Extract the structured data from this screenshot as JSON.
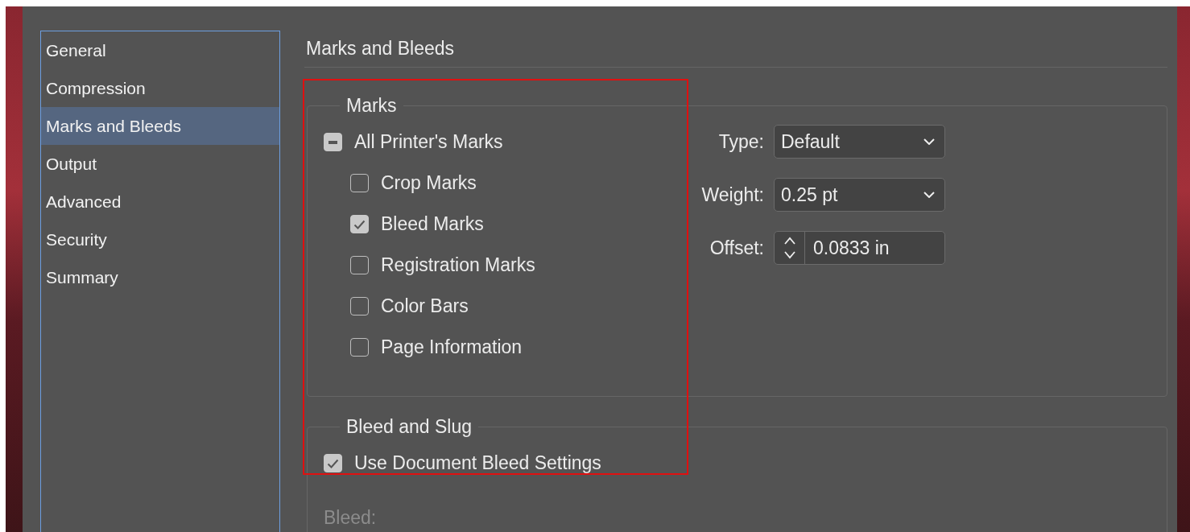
{
  "sidebar": {
    "items": [
      {
        "label": "General",
        "selected": false
      },
      {
        "label": "Compression",
        "selected": false
      },
      {
        "label": "Marks and Bleeds",
        "selected": true
      },
      {
        "label": "Output",
        "selected": false
      },
      {
        "label": "Advanced",
        "selected": false
      },
      {
        "label": "Security",
        "selected": false
      },
      {
        "label": "Summary",
        "selected": false
      }
    ]
  },
  "panel": {
    "title": "Marks and Bleeds",
    "marks": {
      "legend": "Marks",
      "all": {
        "label": "All Printer's Marks",
        "indeterminate": true
      },
      "items": [
        {
          "label": "Crop Marks",
          "checked": false
        },
        {
          "label": "Bleed Marks",
          "checked": true
        },
        {
          "label": "Registration Marks",
          "checked": false
        },
        {
          "label": "Color Bars",
          "checked": false
        },
        {
          "label": "Page Information",
          "checked": false
        }
      ],
      "settings": [
        {
          "label": "Type:",
          "kind": "select",
          "value": "Default"
        },
        {
          "label": "Weight:",
          "kind": "select",
          "value": "0.25 pt"
        },
        {
          "label": "Offset:",
          "kind": "stepper",
          "value": "0.0833 in"
        }
      ]
    },
    "bleed_and_slug": {
      "legend": "Bleed and Slug",
      "use_document": {
        "label": "Use Document Bleed Settings",
        "checked": true
      },
      "bleed_label": {
        "text": "Bleed:",
        "disabled": true
      }
    }
  }
}
